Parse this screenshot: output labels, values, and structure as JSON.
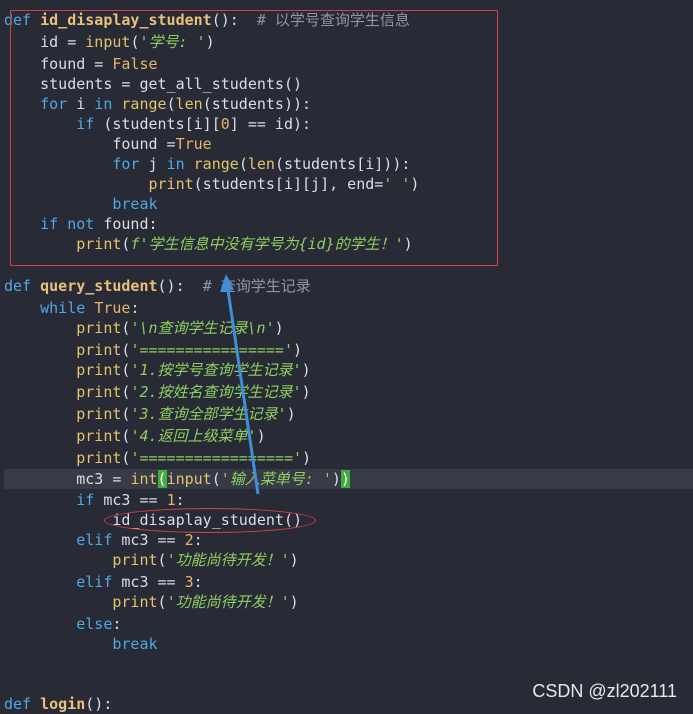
{
  "code": {
    "l1": {
      "kw": "def",
      "name": "id_disaplay_student",
      "tail": "():  ",
      "comment": "# 以学号查询学生信息"
    },
    "l2": {
      "a": "id = ",
      "fn": "input",
      "b": "(",
      "str": "'学号: '",
      "c": ")"
    },
    "l3": {
      "a": "found = ",
      "bool": "False"
    },
    "l4": {
      "a": "students = get_all_students()"
    },
    "l5": {
      "kw1": "for",
      "a": " i ",
      "kw2": "in",
      "b": " ",
      "fn1": "range",
      "c": "(",
      "fn2": "len",
      "d": "(students)):"
    },
    "l6": {
      "kw": "if",
      "a": " (students[i][",
      "num": "0",
      "b": "] == id):"
    },
    "l7": {
      "a": "found =",
      "bool": "True"
    },
    "l8": {
      "kw1": "for",
      "a": " j ",
      "kw2": "in",
      "b": " ",
      "fn1": "range",
      "c": "(",
      "fn2": "len",
      "d": "(students[i])):"
    },
    "l9": {
      "fn": "print",
      "a": "(students[i][j], end=",
      "str": "' '",
      "b": ")"
    },
    "l10": {
      "kw": "break"
    },
    "l11": {
      "kw1": "if",
      "a": " ",
      "kw2": "not",
      "b": " found:"
    },
    "l12": {
      "fn": "print",
      "a": "(",
      "str": "f'学生信息中没有学号为{id}的学生！'",
      "b": ")"
    },
    "l13": {
      "kw": "def",
      "name": "query_student",
      "tail": "():  ",
      "comment": "# 查询学生记录"
    },
    "l14": {
      "kw": "while",
      "a": " ",
      "bool": "True",
      "b": ":"
    },
    "l15": {
      "fn": "print",
      "a": "(",
      "str": "'\\n查询学生记录\\n'",
      "b": ")"
    },
    "l16": {
      "fn": "print",
      "a": "(",
      "str": "'================'",
      "b": ")"
    },
    "l17": {
      "fn": "print",
      "a": "(",
      "str": "'1.按学号查询学生记录'",
      "b": ")"
    },
    "l18": {
      "fn": "print",
      "a": "(",
      "str": "'2.按姓名查询学生记录'",
      "b": ")"
    },
    "l19": {
      "fn": "print",
      "a": "(",
      "str": "'3.查询全部学生记录'",
      "b": ")"
    },
    "l20": {
      "fn": "print",
      "a": "(",
      "str": "'4.返回上级菜单'",
      "b": ")"
    },
    "l21": {
      "fn": "print",
      "a": "(",
      "str": "'================='",
      "b": ")"
    },
    "l22": {
      "a": "mc3 = ",
      "fn1": "int",
      "open": "(",
      "fn2": "input",
      "b": "(",
      "str": "'输入菜单号: '",
      "c": ")",
      "close": ")"
    },
    "l23": {
      "kw": "if",
      "a": " mc3 == ",
      "num": "1",
      "b": ":"
    },
    "l24": {
      "a": "id_disaplay_student()"
    },
    "l25": {
      "kw": "elif",
      "a": " mc3 == ",
      "num": "2",
      "b": ":"
    },
    "l26": {
      "fn": "print",
      "a": "(",
      "str": "'功能尚待开发！'",
      "b": ")"
    },
    "l27": {
      "kw": "elif",
      "a": " mc3 == ",
      "num": "3",
      "b": ":"
    },
    "l28": {
      "fn": "print",
      "a": "(",
      "str": "'功能尚待开发！'",
      "b": ")"
    },
    "l29": {
      "kw": "else",
      "a": ":"
    },
    "l30": {
      "kw": "break"
    },
    "l31": {
      "kw": "def",
      "name": "login",
      "tail": "():"
    }
  },
  "watermark": "CSDN @zl202111",
  "colors": {
    "annotation_red": "#d6404a",
    "arrow_blue": "#3f8fd8",
    "bracket_highlight": "#3fae3f"
  }
}
